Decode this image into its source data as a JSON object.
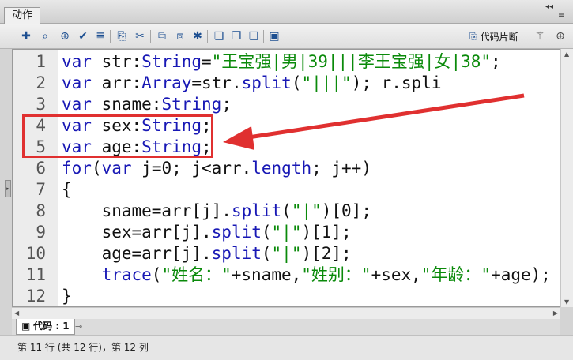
{
  "panel": {
    "title": "动作"
  },
  "toolbar": {
    "icons": [
      "add-statement-icon",
      "find-icon",
      "target-icon",
      "check-syntax-icon",
      "auto-format-icon",
      "code-hint-icon",
      "debug-icon",
      "collapse-braces-icon",
      "collapse-selection-icon",
      "expand-all-icon",
      "comment-block-icon",
      "comment-line-icon",
      "uncomment-icon",
      "script-assist-icon"
    ],
    "snippets_label": "代码片断"
  },
  "accent_colors": {
    "keyword": "#1818b5",
    "string": "#0a8a0a",
    "annotation": "#e03030"
  },
  "editor": {
    "lines": [
      {
        "no": "1",
        "code": "var str:String=\"王宝强|男|39|||李王宝强|女|38\";"
      },
      {
        "no": "2",
        "code": "var arr:Array=str.split(\"|||\"); r.spli"
      },
      {
        "no": "3",
        "code": "var sname:String;"
      },
      {
        "no": "4",
        "code": "var sex:String;"
      },
      {
        "no": "5",
        "code": "var age:String;"
      },
      {
        "no": "6",
        "code": "for(var j=0; j<arr.length; j++)"
      },
      {
        "no": "7",
        "code": "{"
      },
      {
        "no": "8",
        "code": "    sname=arr[j].split(\"|\")[0];"
      },
      {
        "no": "9",
        "code": "    sex=arr[j].split(\"|\")[1];"
      },
      {
        "no": "10",
        "code": "    age=arr[j].split(\"|\")[2];"
      },
      {
        "no": "11",
        "code": "    trace(\"姓名：\"+sname,\"姓别：\"+sex,\"年龄：\"+age);"
      },
      {
        "no": "12",
        "code": "}"
      }
    ]
  },
  "tabs": {
    "code_tab": "代码 : 1"
  },
  "status": {
    "text": "第 11 行 (共 12 行)，第 12 列"
  }
}
